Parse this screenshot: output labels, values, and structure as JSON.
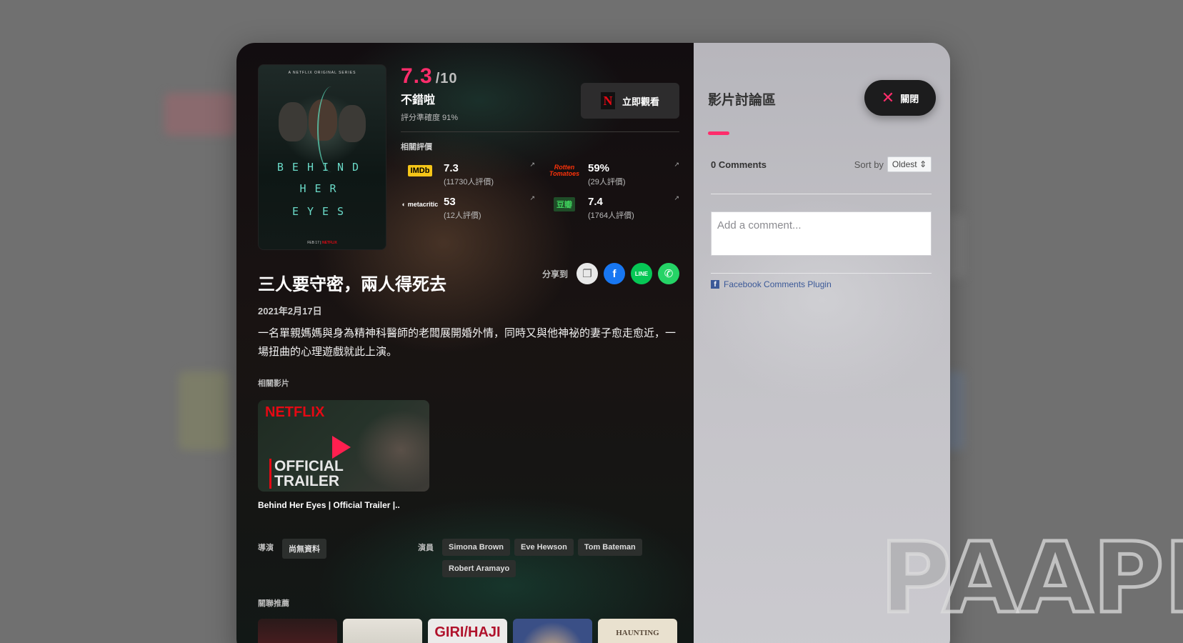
{
  "movie": {
    "score": "7.3",
    "score_max": "/10",
    "verdict": "不錯啦",
    "accuracy": "評分準確度 91%",
    "watch_label": "立即觀看",
    "related_ratings_label": "相關評價",
    "ratings": [
      {
        "source": "IMDb",
        "value": "7.3",
        "count": "(11730人評價)"
      },
      {
        "source": "Rotten Tomatoes",
        "value": "59%",
        "count": "(29人評價)"
      },
      {
        "source": "metacritic",
        "value": "53",
        "count": "(12人評價)"
      },
      {
        "source": "豆瓣",
        "value": "7.4",
        "count": "(1764人評價)"
      }
    ],
    "title": "三人要守密，兩人得死去",
    "date": "2021年2月17日",
    "description": "一名單親媽媽與身為精神科醫師的老闆展開婚外情，同時又與他神祕的妻子愈走愈近，一場扭曲的心理遊戲就此上演。",
    "share_label": "分享到",
    "related_videos_label": "相關影片",
    "video": {
      "brand": "NETFLIX",
      "overlay_line1": "OFFICIAL",
      "overlay_line2": "TRAILER",
      "title": "Behind Her Eyes | Official Trailer |.."
    },
    "director_label": "導演",
    "director": "尚無資料",
    "cast_label": "演員",
    "cast": [
      "Simona Brown",
      "Eve Hewson",
      "Tom Bateman",
      "Robert Aramayo"
    ],
    "recommend_label": "關聯推薦",
    "recommendations": [
      "",
      "",
      "GIRI/HAJI",
      "",
      "HAUNTING"
    ],
    "poster": {
      "top_text": "A NETFLIX ORIGINAL SERIES",
      "title_lines": [
        "BEHIND",
        "HER",
        "EYES"
      ],
      "date": "FEB 17",
      "brand": "NETFLIX"
    }
  },
  "discussion": {
    "title": "影片討論區",
    "close_label": "關閉",
    "comments_count": "0 Comments",
    "sort_label": "Sort by",
    "sort_value": "Oldest ⇕",
    "comment_placeholder": "Add a comment...",
    "plugin_label": "Facebook Comments Plugin"
  },
  "watermark": "PAAPI",
  "colors": {
    "accent": "#ff2d6b",
    "netflix": "#e50914",
    "imdb": "#f5c518"
  }
}
